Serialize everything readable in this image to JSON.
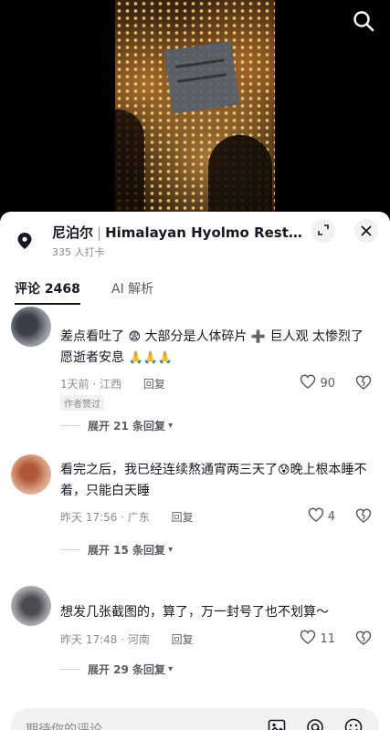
{
  "video": {
    "search_icon": "search-icon"
  },
  "location": {
    "country": "尼泊尔",
    "separator": "|",
    "name": "Himalayan Hyolmo Rest...",
    "checkins": "335 人打卡"
  },
  "tabs": [
    {
      "label": "评论 2468",
      "active": true
    },
    {
      "label": "AI 解析",
      "active": false
    }
  ],
  "comments": [
    {
      "text_a": "差点看吐了",
      "emoji_a": "😨",
      "text_b": " 大部分是人体碎片",
      "emoji_b": "➕",
      "text_c": "巨人观 太惨烈了 愿逝者安息",
      "emoji_c": "🙏🙏🙏",
      "time_loc": "1天前 · 江西",
      "reply": "回复",
      "tag": "作者赞过",
      "likes": "90",
      "expand": "展开 21 条回复"
    },
    {
      "text_a": "看完之后，我已经连续熬通宵两三天了",
      "emoji_a": "😰",
      "text_b": "晚上根本睡不着，只能白天睡",
      "time_loc": "昨天 17:56 · 广东",
      "reply": "回复",
      "likes": "4",
      "expand": "展开 15 条回复"
    },
    {
      "text_a": "想发几张截图的，算了，万一封号了也不划算～",
      "time_loc": "昨天 17:48 · 河南",
      "reply": "回复",
      "likes": "11",
      "expand": "展开 29 条回复"
    }
  ],
  "input": {
    "placeholder": "期待你的评论"
  },
  "colors": {
    "text_primary": "#161823",
    "text_secondary": "#8a8b91",
    "sheet_bg": "#ffffff",
    "input_bg": "#f1f1f2"
  }
}
